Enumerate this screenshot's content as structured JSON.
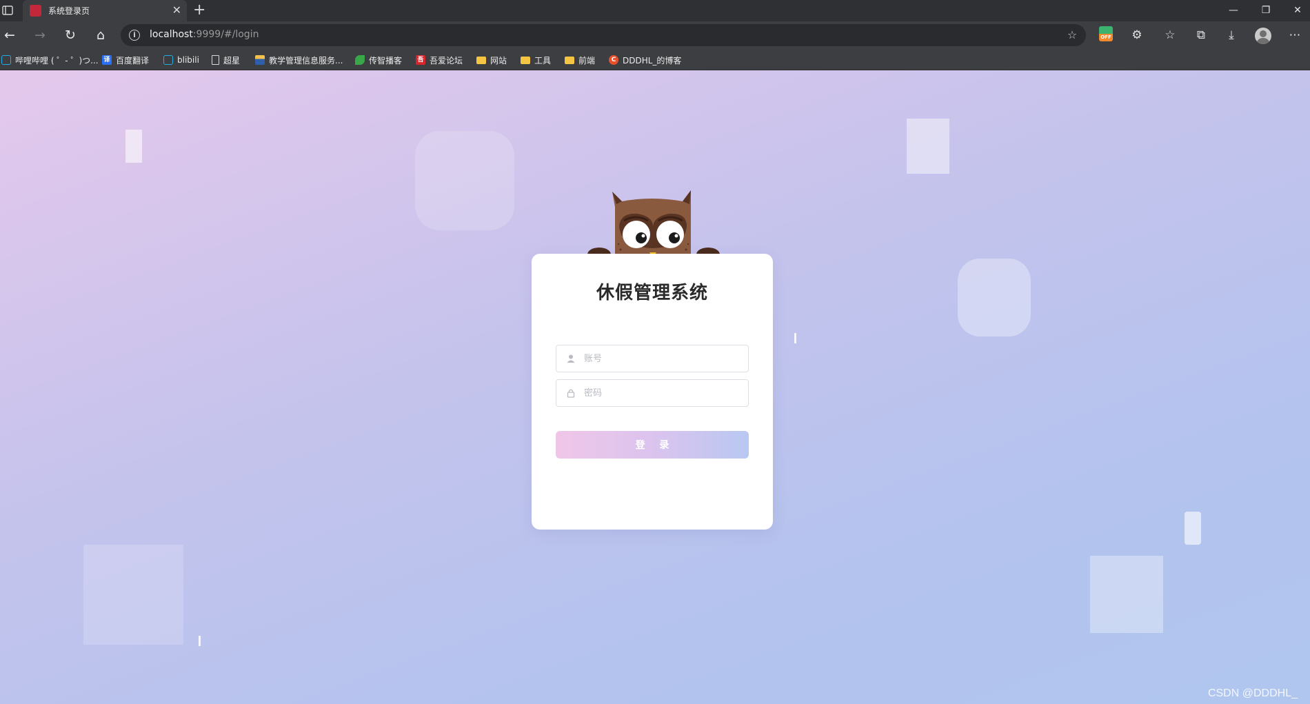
{
  "browser": {
    "tab": {
      "title": "系统登录页",
      "close": "✕"
    },
    "new_tab": "+",
    "window": {
      "minimize": "—",
      "restore": "❐",
      "close": "✕"
    },
    "nav": {
      "back": "←",
      "forward": "→",
      "reload": "↻",
      "home": "⌂"
    },
    "address": {
      "host": "localhost",
      "rest": ":9999/#/login"
    },
    "extension_badge": "OFF",
    "bookmarks": [
      {
        "label": "哔哩哔哩 ( ゜- ゜)つ...",
        "icon": "bilibili-icon",
        "color": "#23ade5"
      },
      {
        "label": "百度翻译",
        "icon": "translate-icon",
        "color": "#2b6ff5"
      },
      {
        "label": "blibili",
        "icon": "bilibili-icon",
        "color": "#23ade5"
      },
      {
        "label": "超星",
        "icon": "page-icon",
        "color": "#d9d9d9"
      },
      {
        "label": "教学管理信息服务...",
        "icon": "school-icon",
        "color": "#2e5fa8"
      },
      {
        "label": "传智播客",
        "icon": "leaf-icon",
        "color": "#3aa64a"
      },
      {
        "label": "吾爱论坛",
        "icon": "forum-icon",
        "color": "#d6262c"
      },
      {
        "label": "网站",
        "icon": "folder-icon",
        "color": "#f4c542"
      },
      {
        "label": "工具",
        "icon": "folder-icon",
        "color": "#f4c542"
      },
      {
        "label": "前端",
        "icon": "folder-icon",
        "color": "#f4c542"
      },
      {
        "label": "DDDHL_的博客",
        "icon": "csdn-icon",
        "color": "#e8502c"
      }
    ]
  },
  "login": {
    "title": "休假管理系统",
    "account_placeholder": "账号",
    "password_placeholder": "密码",
    "submit_label": "登 录"
  },
  "watermark": "CSDN @DDDHL_",
  "colors": {
    "background_start": "#e5c8ec",
    "background_end": "#b0c6ee",
    "button_start": "#f0c6e8",
    "button_end": "#b8c8f2",
    "owl_body": "#8a5a3e"
  }
}
